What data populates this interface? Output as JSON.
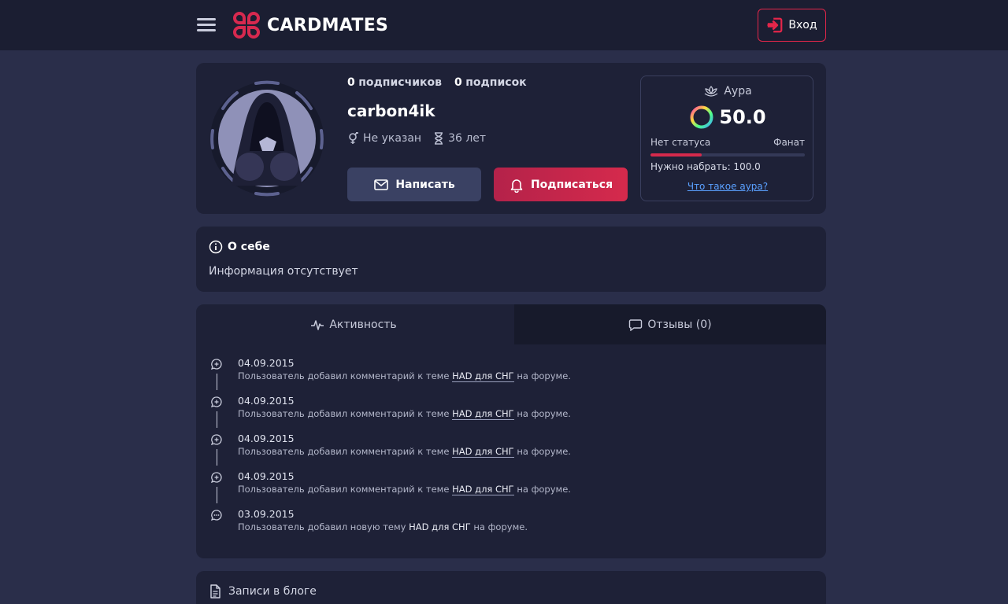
{
  "header": {
    "brand": "CARDMATES",
    "login_label": "Вход",
    "accent_color": "#e4264a"
  },
  "profile": {
    "followers": "0",
    "followers_label": "подписчиков",
    "following": "0",
    "following_label": "подписок",
    "username": "carbon4ik",
    "gender": "Не указан",
    "age": "36 лет",
    "write_label": "Написать",
    "subscribe_label": "Подписаться"
  },
  "aura": {
    "title": "Аура",
    "value": "50.0",
    "status_left": "Нет статуса",
    "status_right": "Фанат",
    "progress_percent": 33,
    "need": "Нужно набрать: 100.0",
    "link": "Что такое аура?"
  },
  "about": {
    "title": "О себе",
    "text": "Информация отсутствует"
  },
  "tabs": {
    "activity": "Активность",
    "reviews": "Отзывы (0)"
  },
  "activity": [
    {
      "date": "04.09.2015",
      "text_before": "Пользователь добавил комментарий к теме",
      "topic": "HAD для СНГ",
      "text_after": "на форуме.",
      "icon": "comment-plus-icon",
      "linked": true
    },
    {
      "date": "04.09.2015",
      "text_before": "Пользователь добавил комментарий к теме",
      "topic": "HAD для СНГ",
      "text_after": "на форуме.",
      "icon": "comment-plus-icon",
      "linked": true
    },
    {
      "date": "04.09.2015",
      "text_before": "Пользователь добавил комментарий к теме",
      "topic": "HAD для СНГ",
      "text_after": "на форуме.",
      "icon": "comment-plus-icon",
      "linked": true
    },
    {
      "date": "04.09.2015",
      "text_before": "Пользователь добавил комментарий к теме",
      "topic": "HAD для СНГ",
      "text_after": "на форуме.",
      "icon": "comment-plus-icon",
      "linked": true
    },
    {
      "date": "03.09.2015",
      "text_before": "Пользователь добавил новую тему",
      "topic": "HAD для СНГ",
      "text_after": "на форуме.",
      "icon": "chat-dots-icon",
      "linked": false
    }
  ],
  "blog": {
    "title": "Записи в блоге"
  }
}
